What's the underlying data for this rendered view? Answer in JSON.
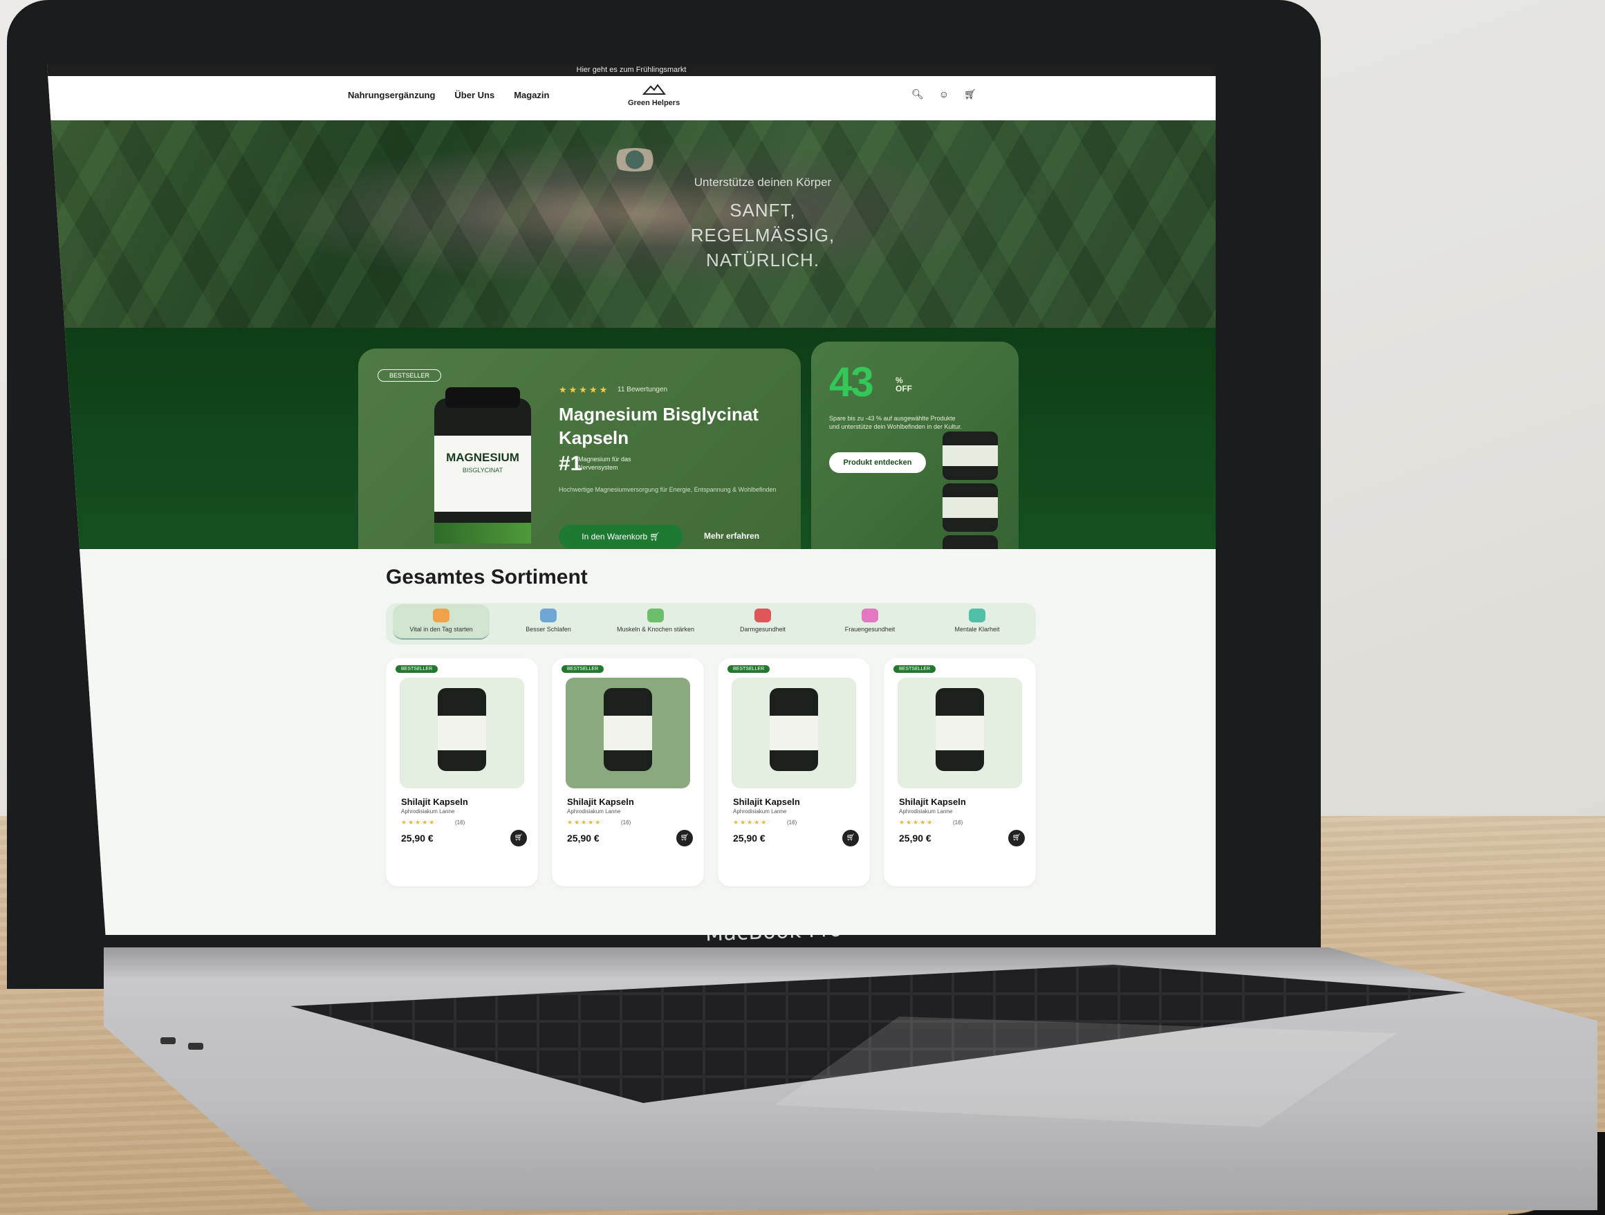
{
  "device": {
    "brand_label": "MacBook Pro"
  },
  "store": {
    "announcement": "Hier geht es zum Frühlingsmarkt",
    "nav": {
      "links": [
        "Nahrungsergänzung",
        "Über Uns",
        "Magazin"
      ],
      "logo_text": "Green Helpers",
      "icons": [
        "search-icon",
        "account-icon",
        "cart-icon"
      ]
    },
    "hero": {
      "subtitle": "Unterstütze deinen Körper",
      "headline_lines": [
        "SANFT,",
        "REGELMÄSSIG,",
        "NATÜRLICH."
      ]
    },
    "featured": {
      "badge": "BESTSELLER",
      "rating_stars": "★★★★★",
      "reviews": "11 Bewertungen",
      "title_line1": "Magnesium Bisglycinat",
      "title_line2": "Kapseln",
      "rank_number": "#1",
      "rank_text": "Magnesium für das Nervensystem",
      "description": "Hochwertige Magnesiumversorgung für Energie, Entspannung & Wohlbefinden",
      "add_to_cart": "In den Warenkorb",
      "learn_more": "Mehr erfahren",
      "jar_label_main": "MAGNESIUM",
      "jar_label_sub": "BISGLYCINAT"
    },
    "sale": {
      "percent": "43",
      "suffix": "% OFF",
      "text": "Spare bis zu -43 % auf ausgewählte Produkte und unterstütze dein Wohlbefinden in der Kultur.",
      "button": "Produkt entdecken"
    },
    "catalog": {
      "heading": "Gesamtes Sortiment",
      "categories": [
        {
          "label": "Vital in den Tag starten",
          "icon": "sun-icon",
          "color": "#f0a24a"
        },
        {
          "label": "Besser Schlafen",
          "icon": "moon-icon",
          "color": "#6fa6d6"
        },
        {
          "label": "Muskeln & Knochen stärken",
          "icon": "muscle-icon",
          "color": "#6cbf6a"
        },
        {
          "label": "Darmgesundheit",
          "icon": "gut-icon",
          "color": "#e1565a"
        },
        {
          "label": "Frauengesundheit",
          "icon": "heart-icon",
          "color": "#e377c2"
        },
        {
          "label": "Mentale Klarheit",
          "icon": "chat-icon",
          "color": "#4fbfa5"
        }
      ],
      "products": [
        {
          "badge": "BESTSELLER",
          "name": "Shilajit Kapseln",
          "sub": "Aphrodisiakum Lanne",
          "stars": "★★★★★",
          "count": "(16)",
          "price": "25,90 €"
        },
        {
          "badge": "BESTSELLER",
          "name": "Shilajit Kapseln",
          "sub": "Aphrodisiakum Lanne",
          "stars": "★★★★★",
          "count": "(16)",
          "price": "25,90 €"
        },
        {
          "badge": "BESTSELLER",
          "name": "Shilajit Kapseln",
          "sub": "Aphrodisiakum Lanne",
          "stars": "★★★★★",
          "count": "(16)",
          "price": "25,90 €"
        },
        {
          "badge": "BESTSELLER",
          "name": "Shilajit Kapseln",
          "sub": "Aphrodisiakum Lanne",
          "stars": "★★★★★",
          "count": "(16)",
          "price": "25,90 €"
        }
      ]
    }
  },
  "colors": {
    "brand_dark": "#0f3d17",
    "accent": "#1e7a33",
    "sale": "#34c759"
  }
}
